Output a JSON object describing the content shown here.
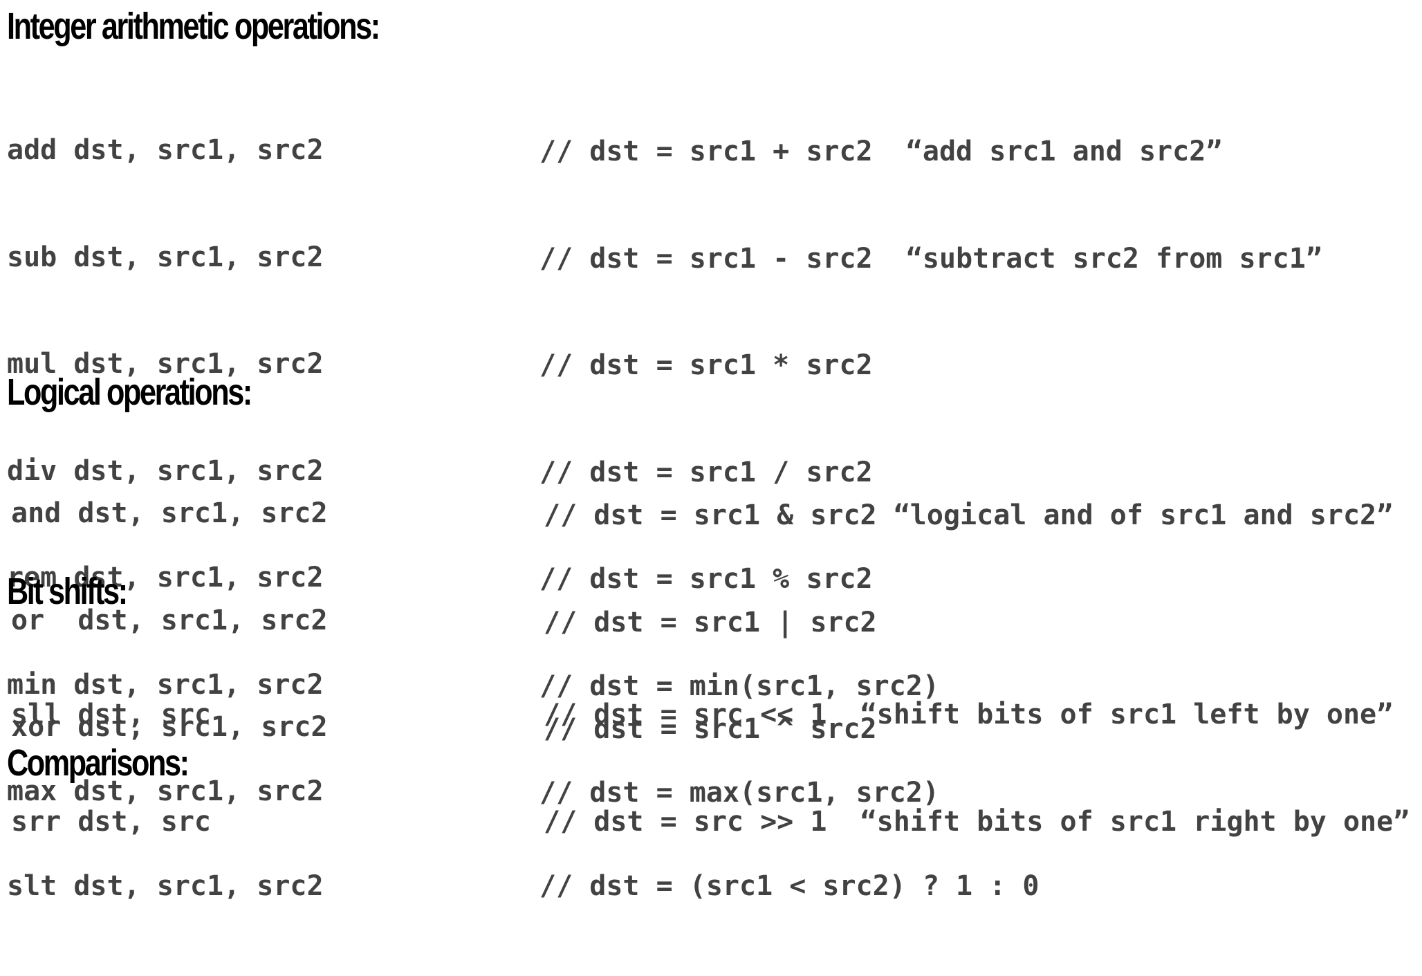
{
  "sections": [
    {
      "heading": "Integer arithmetic operations:",
      "instructions": [
        "add dst, src1, src2",
        "sub dst, src1, src2",
        "mul dst, src1, src2",
        "div dst, src1, src2",
        "rem dst, src1, src2",
        "min dst, src1, src2",
        "max dst, src1, src2"
      ],
      "comments": [
        "// dst = src1 + src2  “add src1 and src2”",
        "// dst = src1 - src2  “subtract src2 from src1”",
        "// dst = src1 * src2",
        "// dst = src1 / src2",
        "// dst = src1 % src2",
        "// dst = min(src1, src2)",
        "// dst = max(src1, src2)"
      ]
    },
    {
      "heading": "Logical operations:",
      "instructions": [
        "and dst, src1, src2",
        "or  dst, src1, src2",
        "xor dst, src1, src2"
      ],
      "comments": [
        "// dst = src1 & src2 “logical and of src1 and src2”",
        "// dst = src1 | src2",
        "// dst = src1 ^ src2"
      ]
    },
    {
      "heading": "Bit shifts:",
      "instructions": [
        "sll dst, src",
        "srr dst, src"
      ],
      "comments": [
        "// dst = src << 1  “shift bits of src1 left by one”",
        "// dst = src >> 1  “shift bits of src1 right by one”"
      ]
    },
    {
      "heading": "Comparisons:",
      "instructions": [
        "slt dst, src1, src2"
      ],
      "comments": [
        "// dst = (src1 < src2) ? 1 : 0"
      ]
    }
  ]
}
